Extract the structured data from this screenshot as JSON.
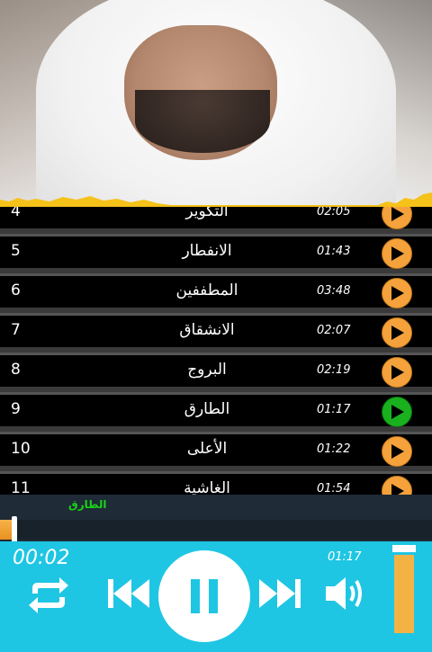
{
  "tracks": [
    {
      "num": "4",
      "title": "التكوير",
      "duration": "02:05",
      "state": "play"
    },
    {
      "num": "5",
      "title": "الانفطار",
      "duration": "01:43",
      "state": "play"
    },
    {
      "num": "6",
      "title": "المطففين",
      "duration": "03:48",
      "state": "play"
    },
    {
      "num": "7",
      "title": "الانشقاق",
      "duration": "02:07",
      "state": "play"
    },
    {
      "num": "8",
      "title": "البروج",
      "duration": "02:19",
      "state": "play"
    },
    {
      "num": "9",
      "title": "الطارق",
      "duration": "01:17",
      "state": "active"
    },
    {
      "num": "10",
      "title": "الأعلى",
      "duration": "01:22",
      "state": "play"
    },
    {
      "num": "11",
      "title": "الغاشية",
      "duration": "01:54",
      "state": "play"
    }
  ],
  "player": {
    "now_playing": "الطارق",
    "elapsed": "00:02",
    "total": "01:17",
    "progress_fraction": 0.03,
    "volume_fraction": 0.95
  },
  "colors": {
    "accent_orange": "#f5a23c",
    "active_green": "#19b21e",
    "controls_bg": "#1fc6e3"
  },
  "icons": [
    "repeat-icon",
    "previous-icon",
    "pause-icon",
    "next-icon",
    "volume-icon",
    "play-icon"
  ]
}
